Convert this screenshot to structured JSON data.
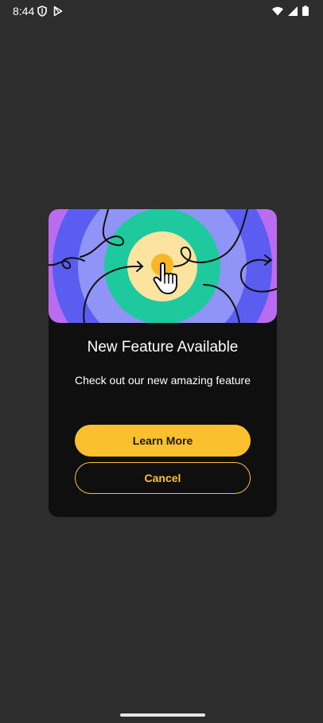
{
  "status_bar": {
    "time": "8:44",
    "icons": [
      "shield-icon",
      "play-store-icon",
      "wifi-icon",
      "signal-icon",
      "battery-icon"
    ]
  },
  "dialog": {
    "title": "New Feature Available",
    "message": "Check out our new amazing feature",
    "primary_button_label": "Learn More",
    "secondary_button_label": "Cancel",
    "hero_icon": "hand-pointer-icon"
  },
  "colors": {
    "background": "#2d2d2d",
    "dialog_background": "#0f0f0f",
    "accent": "#fbc02d",
    "hero_purple": "#b96cf0",
    "hero_blue": "#5b5cf0",
    "hero_light_blue": "#8f94f6",
    "hero_green": "#1ec99e",
    "hero_yellow": "#fde3a0"
  }
}
